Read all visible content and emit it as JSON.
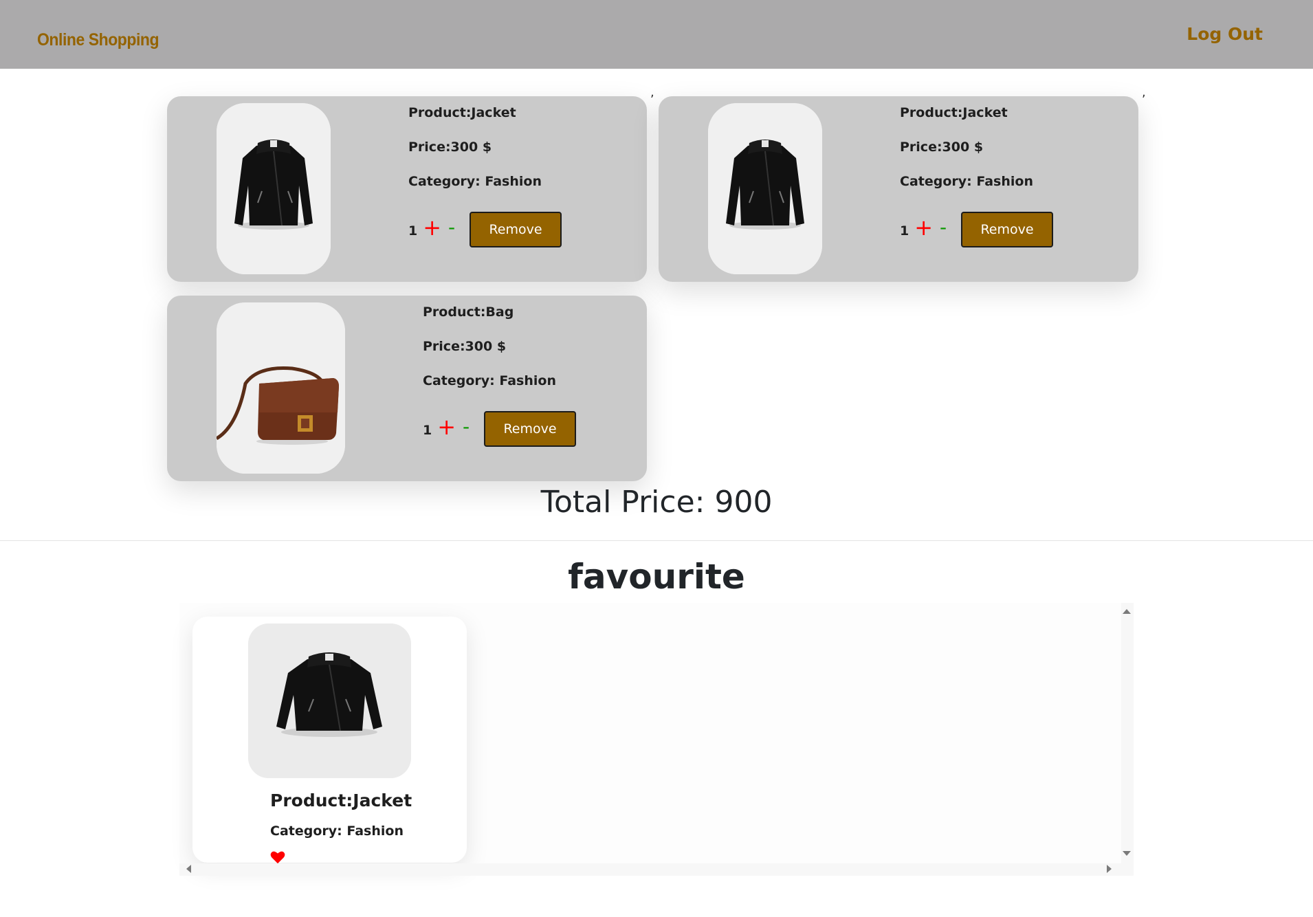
{
  "header": {
    "brand": "Online Shopping",
    "logout_label": "Log Out"
  },
  "cart": {
    "items": [
      {
        "product": "Product:Jacket",
        "price": "Price:300 $",
        "category": "Category: Fashion",
        "quantity": "1",
        "plus": "+",
        "minus": "-",
        "remove_label": "Remove",
        "image_icon": "jacket-image"
      },
      {
        "product": "Product:Jacket",
        "price": "Price:300 $",
        "category": "Category: Fashion",
        "quantity": "1",
        "plus": "+",
        "minus": "-",
        "remove_label": "Remove",
        "image_icon": "jacket-image"
      },
      {
        "product": "Product:Bag",
        "price": "Price:300 $",
        "category": "Category: Fashion",
        "quantity": "1",
        "plus": "+",
        "minus": "-",
        "remove_label": "Remove",
        "image_icon": "bag-image"
      }
    ],
    "separators": [
      ",",
      ","
    ],
    "total": "Total Price: 900"
  },
  "favourites": {
    "title": "favourite",
    "items": [
      {
        "product": "Product:Jacket",
        "category": "Category: Fashion",
        "image_icon": "jacket-image",
        "favourite_icon": "heart-icon"
      }
    ]
  },
  "colors": {
    "navbar": "#abaaab",
    "brand": "#946300",
    "card": "#cacaca",
    "button": "#946300",
    "plus": "#ff0000",
    "minus": "#0a9900",
    "heart": "#ff0000"
  }
}
